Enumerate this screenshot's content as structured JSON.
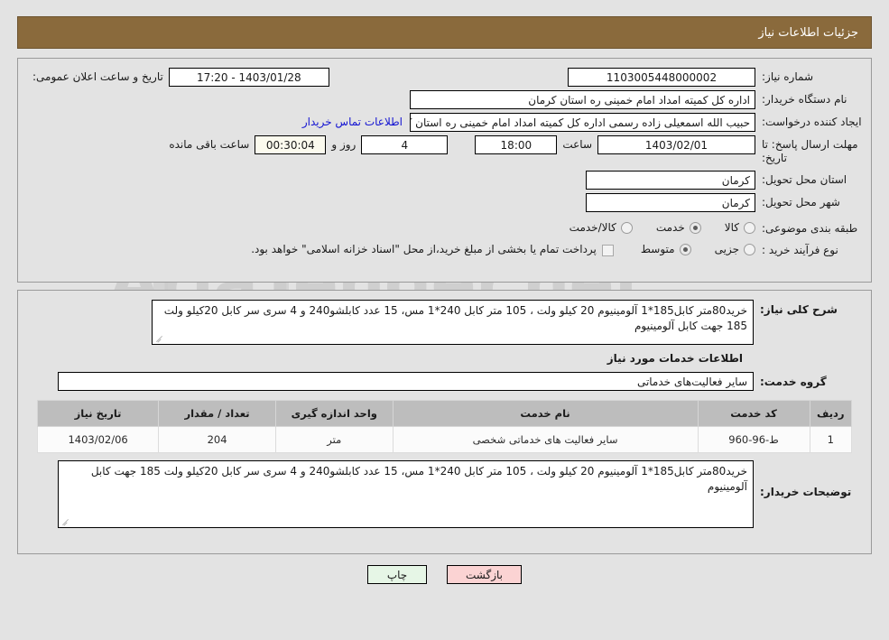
{
  "header": {
    "title": "جزئیات اطلاعات نیاز"
  },
  "form": {
    "need_number_label": "شماره نیاز:",
    "need_number_value": "1103005448000002",
    "public_announce_label": "تاریخ و ساعت اعلان عمومی:",
    "public_announce_value": "1403/01/28 - 17:20",
    "buyer_org_label": "نام دستگاه خریدار:",
    "buyer_org_value": "اداره کل کمیته امداد امام خمینی  ره  استان کرمان",
    "requester_label": "ایجاد کننده درخواست:",
    "requester_value": "حبیب الله اسمعیلی زاده رسمی  اداره کل کمیته امداد امام خمینی  ره  استان ک",
    "contact_link": "اطلاعات تماس خریدار",
    "deadline_label": "مهلت ارسال پاسخ: تا تاریخ:",
    "deadline_date": "1403/02/01",
    "hour_label": "ساعت",
    "hour_value": "18:00",
    "days_value": "4",
    "days_and_label": "روز و",
    "remaining_value": "00:30:04",
    "remaining_label": "ساعت باقی مانده",
    "province_label": "استان محل تحویل:",
    "province_value": "کرمان",
    "city_label": "شهر محل تحویل:",
    "city_value": "کرمان",
    "category_label": "طبقه بندی موضوعی:",
    "category_options": [
      {
        "label": "کالا",
        "selected": false
      },
      {
        "label": "خدمت",
        "selected": true
      },
      {
        "label": "کالا/خدمت",
        "selected": false
      }
    ],
    "process_label": "نوع فرآیند خرید :",
    "process_options": [
      {
        "label": "جزیی",
        "selected": false
      },
      {
        "label": "متوسط",
        "selected": true
      }
    ],
    "treasury_checkbox_label": "پرداخت تمام یا بخشی از مبلغ خرید،از محل \"اسناد خزانه اسلامی\" خواهد بود.",
    "treasury_checked": false
  },
  "details": {
    "summary_label": "شرح کلی نیاز:",
    "summary_value": "خرید80متر کابل185*1 آلومینیوم 20 کیلو ولت ، 105 متر کابل 240*1 مس، 15 عدد کابلشو240 و 4 سری سر کابل 20کیلو ولت 185 جهت کابل آلومینیوم",
    "services_section_title": "اطلاعات خدمات مورد نیاز",
    "service_group_label": "گروه خدمت:",
    "service_group_value": "سایر فعالیت‌های خدماتی",
    "notes_label": "توضیحات خریدار:",
    "notes_value": "خرید80متر کابل185*1 آلومینیوم 20 کیلو ولت ، 105 متر کابل 240*1 مس، 15 عدد کابلشو240 و 4 سری سر کابل 20کیلو ولت 185 جهت کابل آلومینیوم"
  },
  "table": {
    "columns": [
      "ردیف",
      "کد خدمت",
      "نام خدمت",
      "واحد اندازه گیری",
      "تعداد / مقدار",
      "تاریخ نیاز"
    ],
    "rows": [
      {
        "index": "1",
        "code": "ط-96-960",
        "name": "سایر فعالیت های خدماتی شخصی",
        "unit": "متر",
        "qty": "204",
        "date": "1403/02/06"
      }
    ]
  },
  "buttons": {
    "print": "چاپ",
    "back": "بازگشت"
  },
  "watermark": {
    "text": "AriaTender.net"
  },
  "colors": {
    "header_bg": "#8a6a3c",
    "page_bg": "#e3e3e3",
    "link": "#1414d2",
    "print_btn": "#e6f6e6",
    "back_btn": "#fbd3d3"
  }
}
